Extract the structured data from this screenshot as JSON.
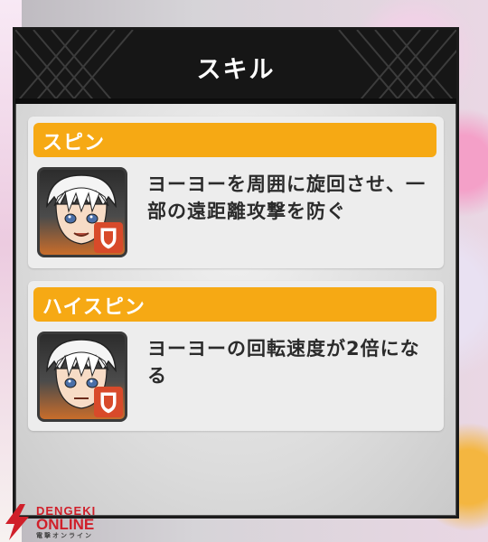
{
  "panel": {
    "title": "スキル"
  },
  "skills": [
    {
      "name": "スピン",
      "description": "ヨーヨーを周囲に旋回させ、一部の遠距離攻撃を防ぐ",
      "icon": "character-portrait-with-shield-icon"
    },
    {
      "name": "ハイスピン",
      "description": "ヨーヨーの回転速度が2倍になる",
      "icon": "character-portrait-with-shield-icon"
    }
  ],
  "watermark": {
    "line1": "DENGEKI",
    "line2": "ONLINE",
    "line3": "電撃オンライン"
  },
  "colors": {
    "header_bg": "#161616",
    "skill_bar": "#f6a914",
    "card_bg": "#ededed",
    "text_dark": "#2b2b2b",
    "watermark_red": "#d01f2a"
  }
}
